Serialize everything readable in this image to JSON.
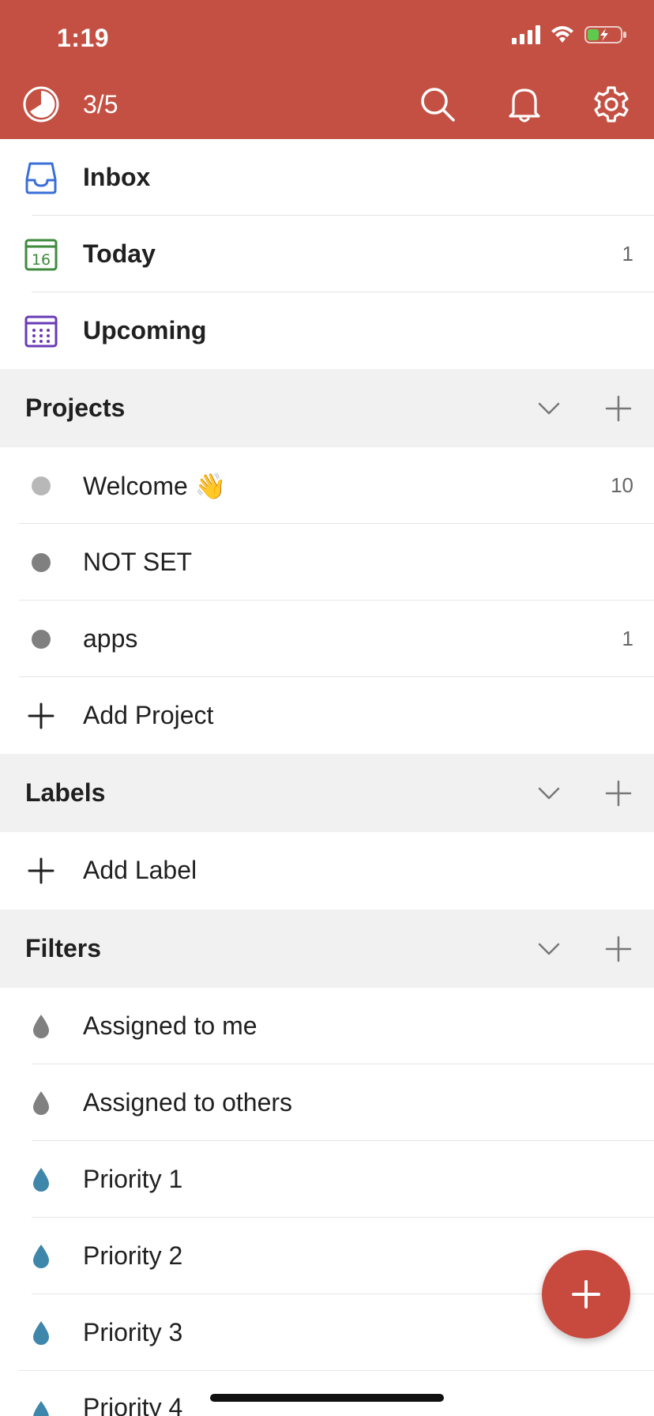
{
  "status_bar": {
    "time": "1:19"
  },
  "toolbar": {
    "karma": "3/5"
  },
  "nav": [
    {
      "label": "Inbox",
      "count": "",
      "icon": "inbox-icon",
      "color": "#3a6fd8"
    },
    {
      "label": "Today",
      "count": "1",
      "icon": "calendar-today-icon",
      "day": "16",
      "color": "#3e8b3d"
    },
    {
      "label": "Upcoming",
      "count": "",
      "icon": "calendar-upcoming-icon",
      "color": "#6a3ab4"
    }
  ],
  "projects": {
    "title": "Projects",
    "items": [
      {
        "label": "Welcome 👋",
        "count": "10",
        "color": "#b8b8b8"
      },
      {
        "label": "NOT SET",
        "count": "",
        "color": "#808080"
      },
      {
        "label": "apps",
        "count": "1",
        "color": "#808080"
      }
    ],
    "add_label": "Add Project"
  },
  "labels": {
    "title": "Labels",
    "add_label": "Add Label"
  },
  "filters": {
    "title": "Filters",
    "items": [
      {
        "label": "Assigned to me",
        "color": "#808080"
      },
      {
        "label": "Assigned to others",
        "color": "#808080"
      },
      {
        "label": "Priority 1",
        "color": "#3f86ab"
      },
      {
        "label": "Priority 2",
        "color": "#3f86ab"
      },
      {
        "label": "Priority 3",
        "color": "#3f86ab"
      },
      {
        "label": "Priority 4",
        "color": "#3f86ab"
      }
    ]
  },
  "colors": {
    "header": "#c35043",
    "fab": "#c8493d",
    "section_bg": "#f1f1f1"
  }
}
